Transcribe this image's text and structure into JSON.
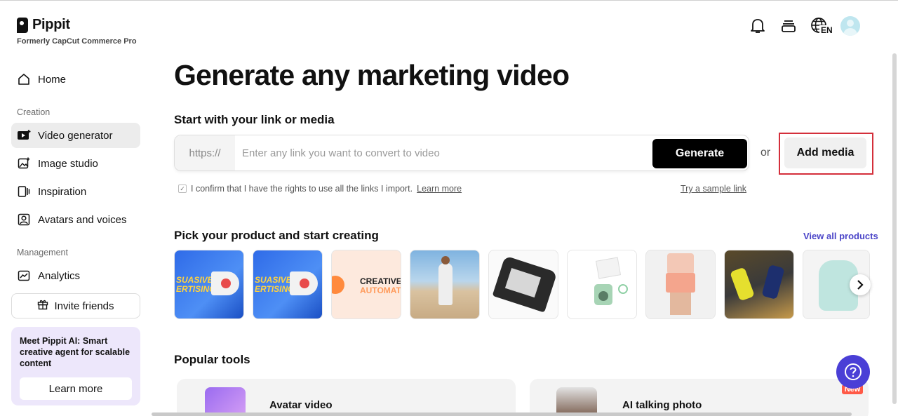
{
  "brand": {
    "name": "Pippit",
    "subtitle": "Formerly CapCut Commerce Pro"
  },
  "sidebar": {
    "home": "Home",
    "creation_label": "Creation",
    "creation_items": [
      {
        "label": "Video generator",
        "icon": "video-plus-icon",
        "active": true
      },
      {
        "label": "Image studio",
        "icon": "image-plus-icon",
        "active": false
      },
      {
        "label": "Inspiration",
        "icon": "inspiration-icon",
        "active": false
      },
      {
        "label": "Avatars and voices",
        "icon": "avatar-icon",
        "active": false
      }
    ],
    "management_label": "Management",
    "analytics": "Analytics",
    "invite": "Invite friends",
    "promo": {
      "text": "Meet Pippit AI: Smart creative agent for scalable content",
      "button": "Learn more"
    }
  },
  "header": {
    "icons": [
      "bell-icon",
      "stack-icon",
      "globe-language-icon",
      "user-avatar"
    ],
    "language": "EN"
  },
  "main": {
    "title": "Generate any marketing video",
    "subhead": "Start with your link or media",
    "link_prefix": "https://",
    "link_placeholder": "Enter any link you want to convert to video",
    "generate_label": "Generate",
    "or_label": "or",
    "add_media_label": "Add media",
    "confirm_text": "I confirm that I have the rights to use all the links I import.",
    "confirm_link": "Learn more",
    "sample_link": "Try a sample link",
    "pick_head": "Pick your product and start creating",
    "view_all": "View all products",
    "tile_texts": {
      "tile1": "SUASIVE\nERTISING",
      "tile2": "SUASIVE\nERTISING",
      "tile3_a": "CREATIVE",
      "tile3_b": "AUTOMAT"
    },
    "popular_head": "Popular tools",
    "tools": [
      {
        "label": "Avatar video"
      },
      {
        "label": "AI talking photo",
        "badge": "New"
      }
    ]
  },
  "colors": {
    "accent": "#4b45c8",
    "help_button": "#4a3fd6",
    "highlight_border": "#d42f3b",
    "active_nav": "#ececec"
  }
}
